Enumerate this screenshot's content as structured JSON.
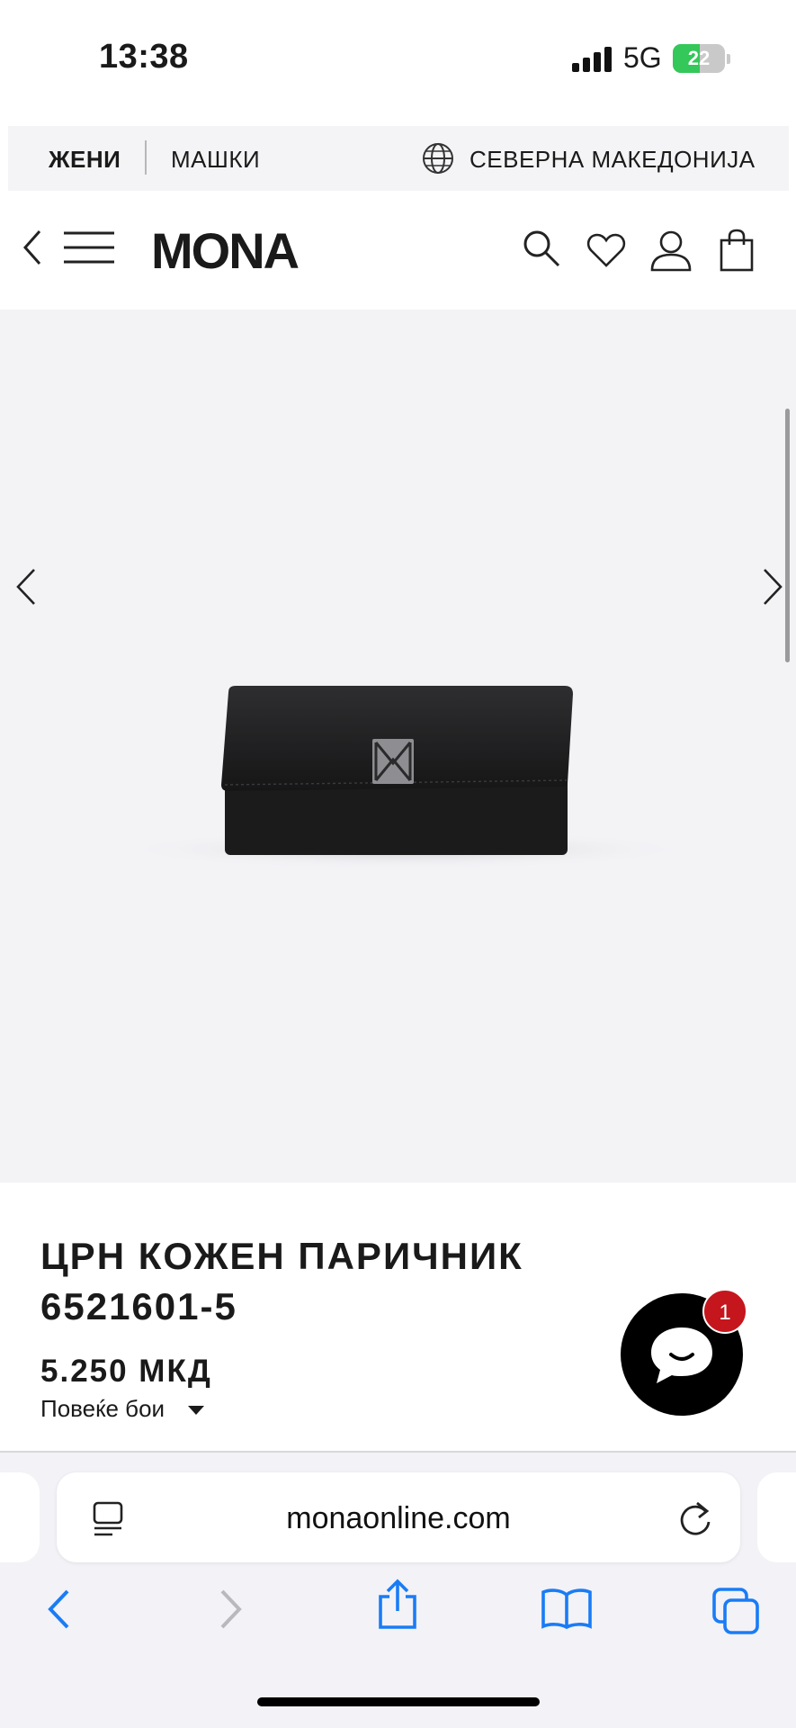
{
  "status": {
    "time": "13:38",
    "network": "5G",
    "battery": "22"
  },
  "region_bar": {
    "women": "ЖЕНИ",
    "men": "МАШКИ",
    "country": "СЕВЕРНА МАКЕДОНИЈА"
  },
  "header": {
    "logo": "MONA"
  },
  "icons": {
    "back": "chevron-left-icon",
    "menu": "hamburger-icon",
    "search": "search-icon",
    "wishlist": "heart-icon",
    "account": "user-icon",
    "cart": "shopping-bag-icon",
    "globe": "globe-icon",
    "chat": "chat-icon",
    "reader": "reader-icon",
    "reload": "reload-icon",
    "share": "share-icon",
    "bookmarks": "book-icon",
    "tabs": "tabs-icon"
  },
  "product": {
    "title_line1": "ЦРН КОЖЕН ПАРИЧНИК",
    "title_line2": "6521601-5",
    "price": "5.250 МКД",
    "colors_label": "Повеќе бои"
  },
  "chat": {
    "badge": "1"
  },
  "browser": {
    "url": "monaonline.com"
  },
  "colors": {
    "accent": "#1a1a1a",
    "badge": "#c4161c",
    "safari_blue": "#1a7cf5",
    "gallery_bg": "#f3f3f6"
  }
}
